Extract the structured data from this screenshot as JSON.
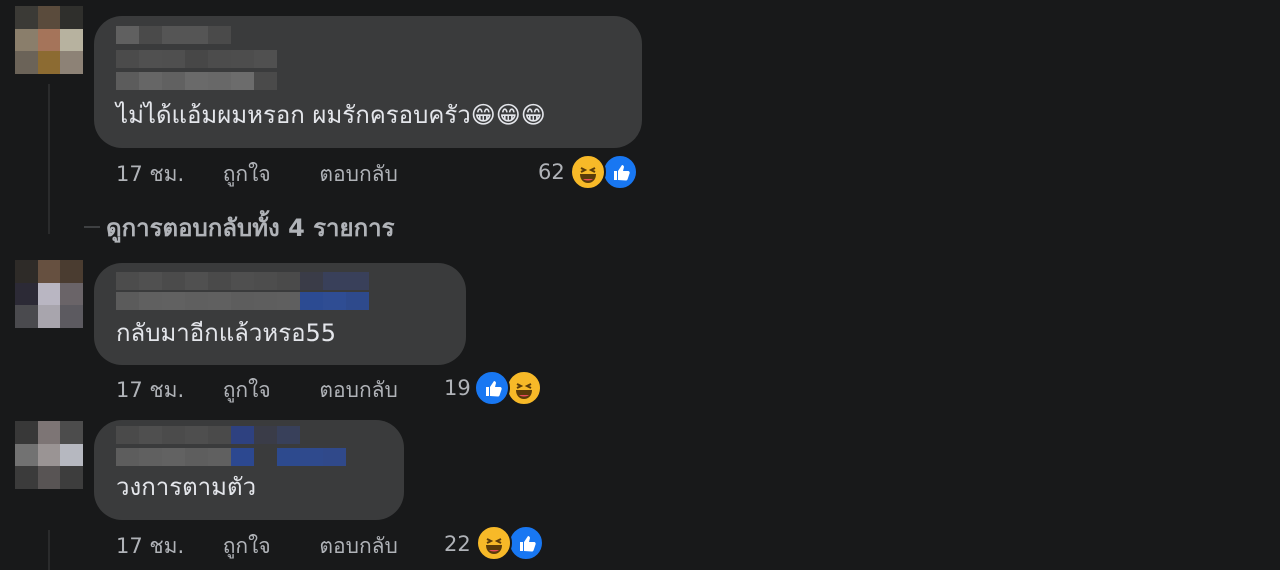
{
  "comments": [
    {
      "text": "ไม่ได้แอ้มผมหรอก ผมรักครอบครัว😁😁😁",
      "time": "17 ชม.",
      "like_label": "ถูกใจ",
      "reply_label": "ตอบกลับ",
      "reaction_count": "62",
      "reaction_icons": [
        "haha-icon",
        "like-icon"
      ]
    },
    {
      "text": "กลับมาอีกแล้วหรอ55",
      "time": "17 ชม.",
      "like_label": "ถูกใจ",
      "reply_label": "ตอบกลับ",
      "reaction_count": "19",
      "reaction_icons": [
        "like-icon",
        "haha-icon"
      ]
    },
    {
      "text": "วงการตามตัว",
      "time": "17 ชม.",
      "like_label": "ถูกใจ",
      "reply_label": "ตอบกลับ",
      "reaction_count": "22",
      "reaction_icons": [
        "haha-icon",
        "like-icon"
      ]
    }
  ],
  "view_replies": "ดูการตอบกลับทั้ง 4 รายการ",
  "colors": {
    "background": "#18191a",
    "bubble": "#3a3b3c",
    "text": "#e4e6eb",
    "meta": "#b0b3b8",
    "like_blue": "#1877f2",
    "haha_yellow": "#f7b928"
  }
}
